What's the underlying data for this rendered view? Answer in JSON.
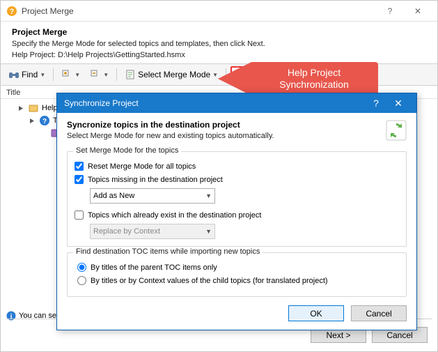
{
  "window": {
    "title": "Project Merge",
    "help_btn": "?",
    "close_btn": "✕"
  },
  "header": {
    "title": "Project Merge",
    "desc": "Specify the Merge Mode for selected topics and templates, then click Next.",
    "path_label": "Help Project: D:\\Help Projects\\GettingStarted.hsmx"
  },
  "toolbar": {
    "find": "Find",
    "select_merge": "Select Merge Mode"
  },
  "columns": {
    "title": "Title"
  },
  "tree": {
    "root": "HelpS",
    "node1": "Ta"
  },
  "hint": "You can sel",
  "buttons": {
    "next": "Next >",
    "cancel": "Cancel"
  },
  "callout": {
    "line1": "Help Project",
    "line2": "Synchronization"
  },
  "dialog": {
    "title": "Synchronize Project",
    "help_btn": "?",
    "close_btn": "✕",
    "head_title": "Syncronize topics in the destination project",
    "head_desc": "Select Merge Mode for new and existing topics automatically.",
    "group1_legend": "Set Merge Mode for the topics",
    "cb1_label": "Reset Merge Mode for all topics",
    "cb2_label": "Topics missing in the destination project",
    "combo1": "Add as New",
    "cb3_label": "Topics which already exist in the destination project",
    "combo2": "Replace by Context",
    "group2_legend": "Find destination TOC items while importing new topics",
    "r1_label": "By titles of the parent TOC items only",
    "r2_label": "By titles or by Context values of the child topics (for translated project)",
    "ok": "OK",
    "cancel": "Cancel"
  }
}
